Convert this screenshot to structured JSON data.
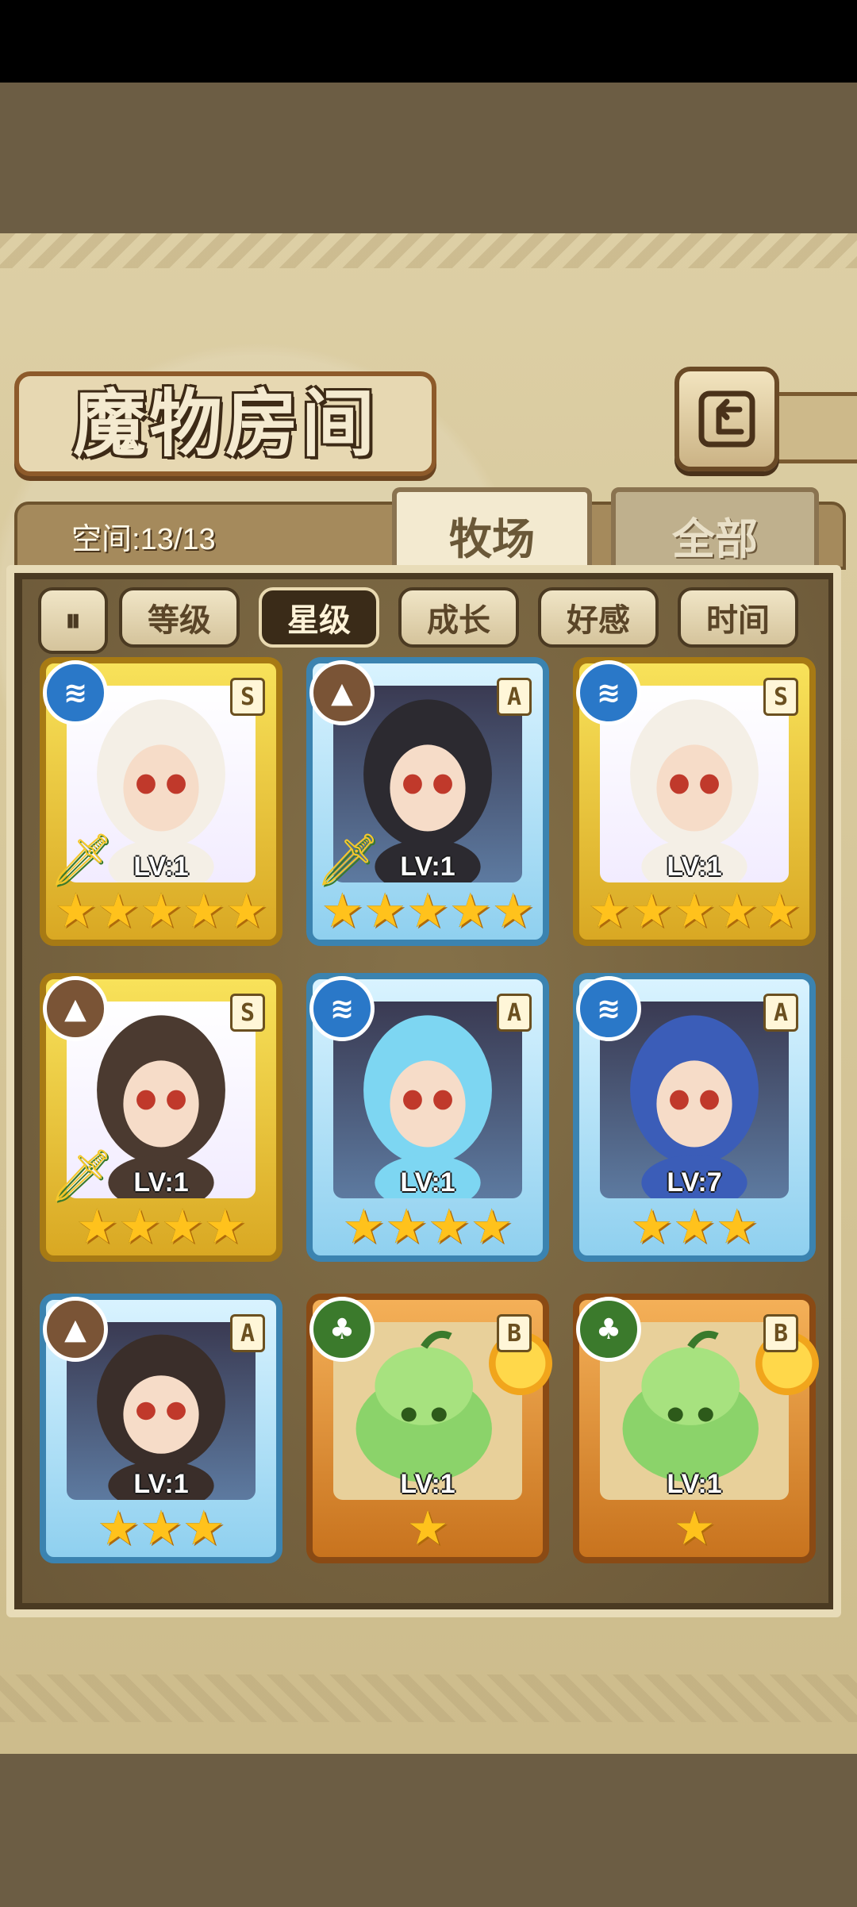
{
  "header": {
    "title": "魔物房间",
    "back_icon": "return-arrow-icon"
  },
  "space": {
    "text": "空间:13/13"
  },
  "tabs": [
    {
      "label": "牧场",
      "active": true
    },
    {
      "label": "全部",
      "active": false
    }
  ],
  "sort": {
    "toggle_icon": "sort-order-icon",
    "filters": [
      {
        "label": "等级",
        "active": false
      },
      {
        "label": "星级",
        "active": true
      },
      {
        "label": "成长",
        "active": false
      },
      {
        "label": "好感",
        "active": false
      },
      {
        "label": "时间",
        "active": false
      }
    ]
  },
  "colors": {
    "gold_card": "#f8e25a",
    "blue_card": "#8fd0ef",
    "orange_card": "#f4b058",
    "star": "#ffc21c",
    "water": "#2a78c8",
    "earth": "#7a5436",
    "wood": "#3b7a2c"
  },
  "monsters": [
    {
      "level": "LV:1",
      "stars": 5,
      "rank": "S",
      "element": "water-icon",
      "frame": "gold",
      "weapon": true
    },
    {
      "level": "LV:1",
      "stars": 5,
      "rank": "A",
      "element": "earth-icon",
      "frame": "blue",
      "weapon": true
    },
    {
      "level": "LV:1",
      "stars": 5,
      "rank": "S",
      "element": "water-icon",
      "frame": "gold",
      "weapon": false
    },
    {
      "level": "LV:1",
      "stars": 4,
      "rank": "S",
      "element": "earth-icon",
      "frame": "gold",
      "weapon": true
    },
    {
      "level": "LV:1",
      "stars": 4,
      "rank": "A",
      "element": "water-icon",
      "frame": "blue",
      "weapon": false
    },
    {
      "level": "LV:7",
      "stars": 3,
      "rank": "A",
      "element": "water-icon",
      "frame": "blue",
      "weapon": false
    },
    {
      "level": "LV:1",
      "stars": 3,
      "rank": "A",
      "element": "earth-icon",
      "frame": "blue",
      "weapon": false
    },
    {
      "level": "LV:1",
      "stars": 1,
      "rank": "B",
      "element": "wood-icon",
      "frame": "orange",
      "weapon": false
    },
    {
      "level": "LV:1",
      "stars": 1,
      "rank": "B",
      "element": "wood-icon",
      "frame": "orange",
      "weapon": false
    }
  ]
}
